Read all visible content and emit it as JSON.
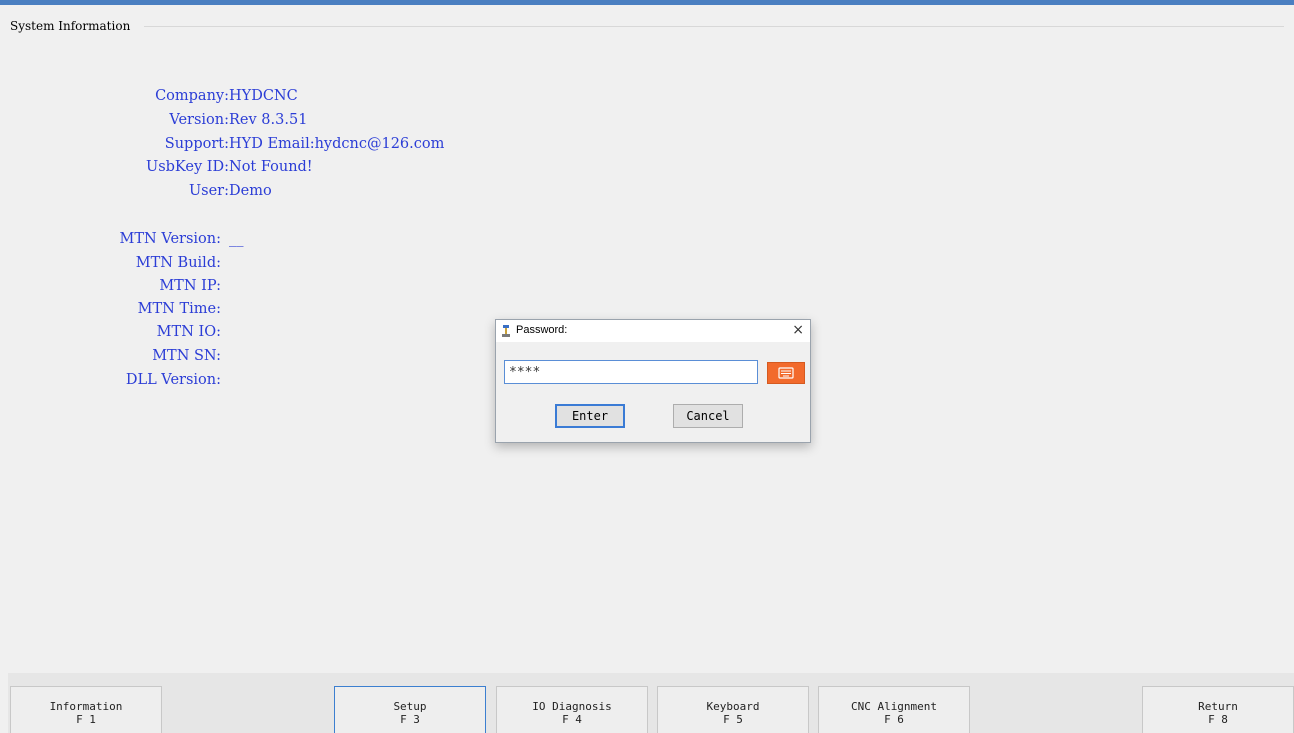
{
  "window": {
    "group_title": "System Information"
  },
  "info": [
    {
      "label": "Company:",
      "value": "HYDCNC"
    },
    {
      "label": "Version:",
      "value": "Rev 8.3.51"
    },
    {
      "label": "Support:",
      "value": "HYD Email:hydcnc@126.com"
    },
    {
      "label": "UsbKey ID:",
      "value": "Not Found!"
    },
    {
      "label": "User:",
      "value": "Demo"
    }
  ],
  "mtn": [
    {
      "label": "MTN Version:",
      "value": "__"
    },
    {
      "label": "MTN Build:",
      "value": ""
    },
    {
      "label": "MTN IP:",
      "value": ""
    },
    {
      "label": "MTN Time:",
      "value": ""
    },
    {
      "label": "MTN IO:",
      "value": ""
    },
    {
      "label": "MTN SN:",
      "value": ""
    },
    {
      "label": "DLL Version:",
      "value": ""
    }
  ],
  "function_keys": [
    {
      "label": "Information",
      "key": "F 1"
    },
    {
      "label": "Setup",
      "key": "F 3",
      "active": true
    },
    {
      "label": "IO Diagnosis",
      "key": "F 4"
    },
    {
      "label": "Keyboard",
      "key": "F 5"
    },
    {
      "label": "CNC Alignment",
      "key": "F 6"
    },
    {
      "label": "Return",
      "key": "F 8"
    }
  ],
  "dialog": {
    "title": "Password:",
    "close_glyph": "×",
    "password_value": "****",
    "enter_label": "Enter",
    "cancel_label": "Cancel",
    "keyboard_icon": "keyboard-icon"
  },
  "colors": {
    "label_blue": "#2b3dd6",
    "accent_orange": "#f26a2c",
    "title_bar_blue": "#4a7fc1"
  }
}
